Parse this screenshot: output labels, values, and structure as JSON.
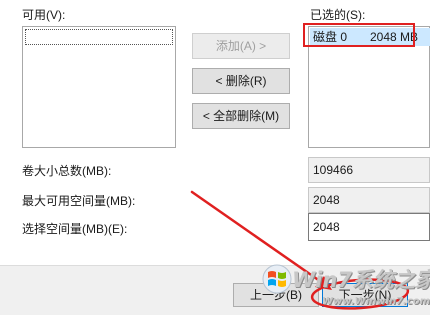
{
  "available": {
    "label": "可用(V):",
    "items": []
  },
  "selected": {
    "label": "已选的(S):",
    "items": [
      {
        "disk": "磁盘 0",
        "size": "2048 MB"
      }
    ]
  },
  "buttons": {
    "add": "添加(A) >",
    "remove": "< 删除(R)",
    "remove_all": "< 全部删除(M)"
  },
  "fields": {
    "total_label": "卷大小总数(MB):",
    "total_value": "109466",
    "max_label": "最大可用空间量(MB):",
    "max_value": "2048",
    "choose_label": "选择空间量(MB)(E):",
    "choose_value": "2048"
  },
  "footer": {
    "back": "上一步(B)",
    "next": "下一步(N)"
  },
  "watermark": {
    "brand": "Win7系统之家",
    "url": "Www.Winwin7.com"
  },
  "colors": {
    "annotation_red": "#e02020",
    "selection_blue": "#cce8ff",
    "footer_bg": "#f0f0f0"
  }
}
